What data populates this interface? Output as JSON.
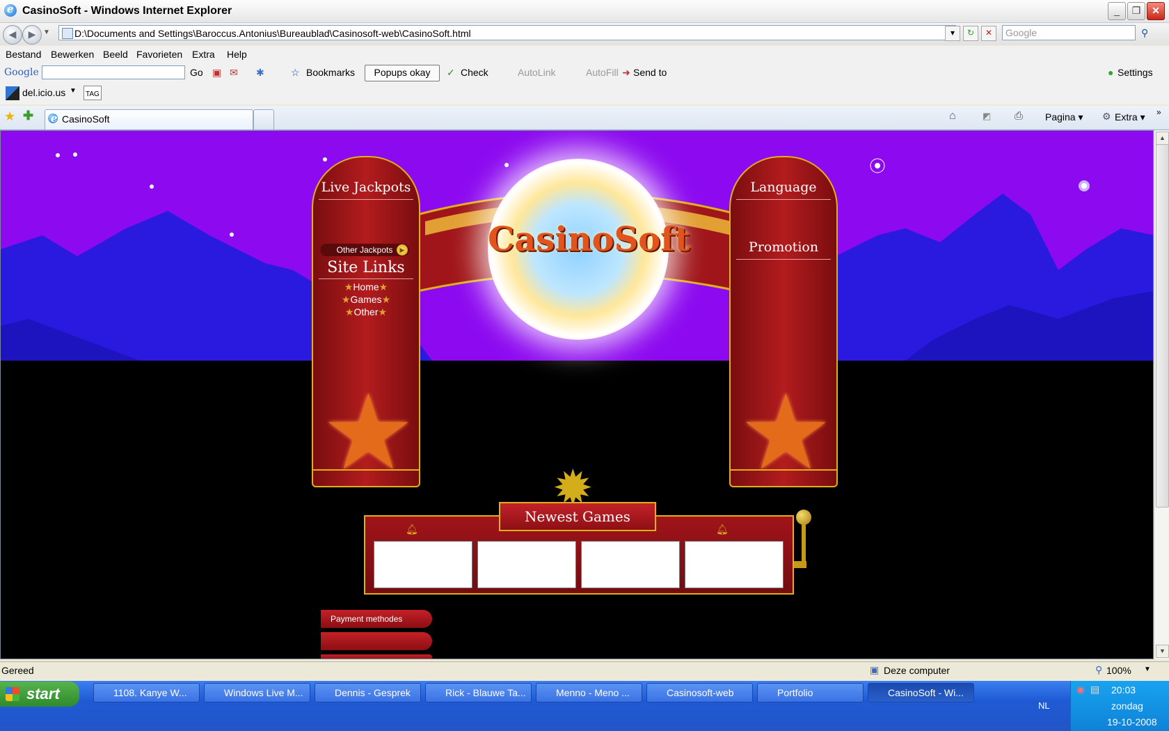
{
  "window": {
    "title": "CasinoSoft - Windows Internet Explorer"
  },
  "address": {
    "url": "D:\\Documents and Settings\\Baroccus.Antonius\\Bureaublad\\Casinosoft-web\\CasinoSoft.html",
    "search_placeholder": "Google"
  },
  "menu": [
    "Bestand",
    "Bewerken",
    "Beeld",
    "Favorieten",
    "Extra",
    "Help"
  ],
  "gtoolbar": {
    "google": "Google",
    "go": "Go",
    "bookmarks": "Bookmarks",
    "popups": "Popups okay",
    "check": "Check",
    "autolink": "AutoLink",
    "autofill": "AutoFill",
    "sendto": "Send to",
    "settings": "Settings"
  },
  "delicious": {
    "label": "del.icio.us",
    "tag": "TAG"
  },
  "tab": {
    "label": "CasinoSoft",
    "pagina": "Pagina",
    "extra": "Extra"
  },
  "page": {
    "left_panel": {
      "title": "Live Jackpots",
      "other_jackpots": "Other Jackpots",
      "site_links": "Site Links",
      "links": [
        "Home",
        "Games",
        "Other"
      ]
    },
    "right_panel": {
      "title": "Language",
      "promotion": "Promotion"
    },
    "logo": "CasinoSoft",
    "newest_games": "Newest Games",
    "payment": "Payment methodes"
  },
  "status": {
    "text": "Gereed",
    "zone": "Deze computer",
    "zoom": "100%"
  },
  "taskbar": {
    "start": "start",
    "tasks": [
      "1108. Kanye W...",
      "Windows Live M...",
      "Dennis - Gesprek",
      "Rick - Blauwe Ta...",
      "Menno - Meno ...",
      "Casinosoft-web",
      "Portfolio",
      "CasinoSoft - Wi..."
    ],
    "lang": "NL",
    "time": "20:03",
    "day": "zondag",
    "date": "19-10-2008"
  },
  "colors": {
    "sky": "#8d0af0",
    "mountains": "#2a1ae0",
    "panel_red": "#b31c1e",
    "gold": "#e0b01a"
  }
}
